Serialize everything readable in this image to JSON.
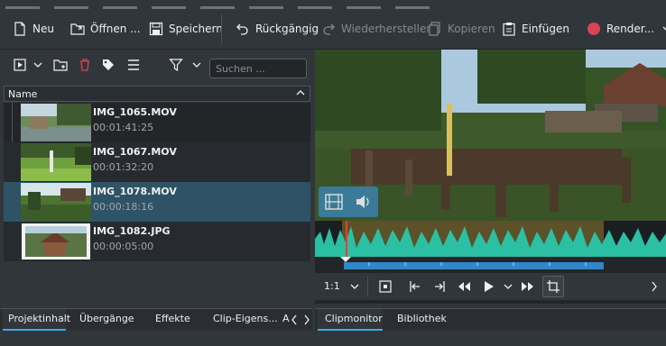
{
  "toolbar": {
    "new_label": "Neu",
    "open_label": "Öffnen ...",
    "save_label": "Speichern",
    "undo_label": "Rückgängig",
    "redo_label": "Wiederherstellen",
    "copy_label": "Kopieren",
    "paste_label": "Einfügen",
    "render_label": "Render..."
  },
  "bin": {
    "search_placeholder": "Suchen ...",
    "column_name": "Name",
    "clips": [
      {
        "name": "IMG_1065.MOV",
        "duration": "00:01:41:25"
      },
      {
        "name": "IMG_1067.MOV",
        "duration": "00:01:32:20"
      },
      {
        "name": "IMG_1078.MOV",
        "duration": "00:00:18:16"
      },
      {
        "name": "IMG_1082.JPG",
        "duration": "00:00:05:00"
      }
    ]
  },
  "left_tabs": [
    "Projektinhalt",
    "Übergänge",
    "Effekte",
    "Clip-Eigens...",
    "A"
  ],
  "monitor": {
    "zoom": "1:1"
  },
  "right_tabs": [
    "Clipmonitor",
    "Bibliothek"
  ],
  "colors": {
    "accent": "#3daee9",
    "selection": "#2e5366",
    "render": "#da4453",
    "waveform": "#2bbfa4",
    "waveform_highlight": "#a68a1f",
    "ruler_zone": "#2f88c9"
  }
}
